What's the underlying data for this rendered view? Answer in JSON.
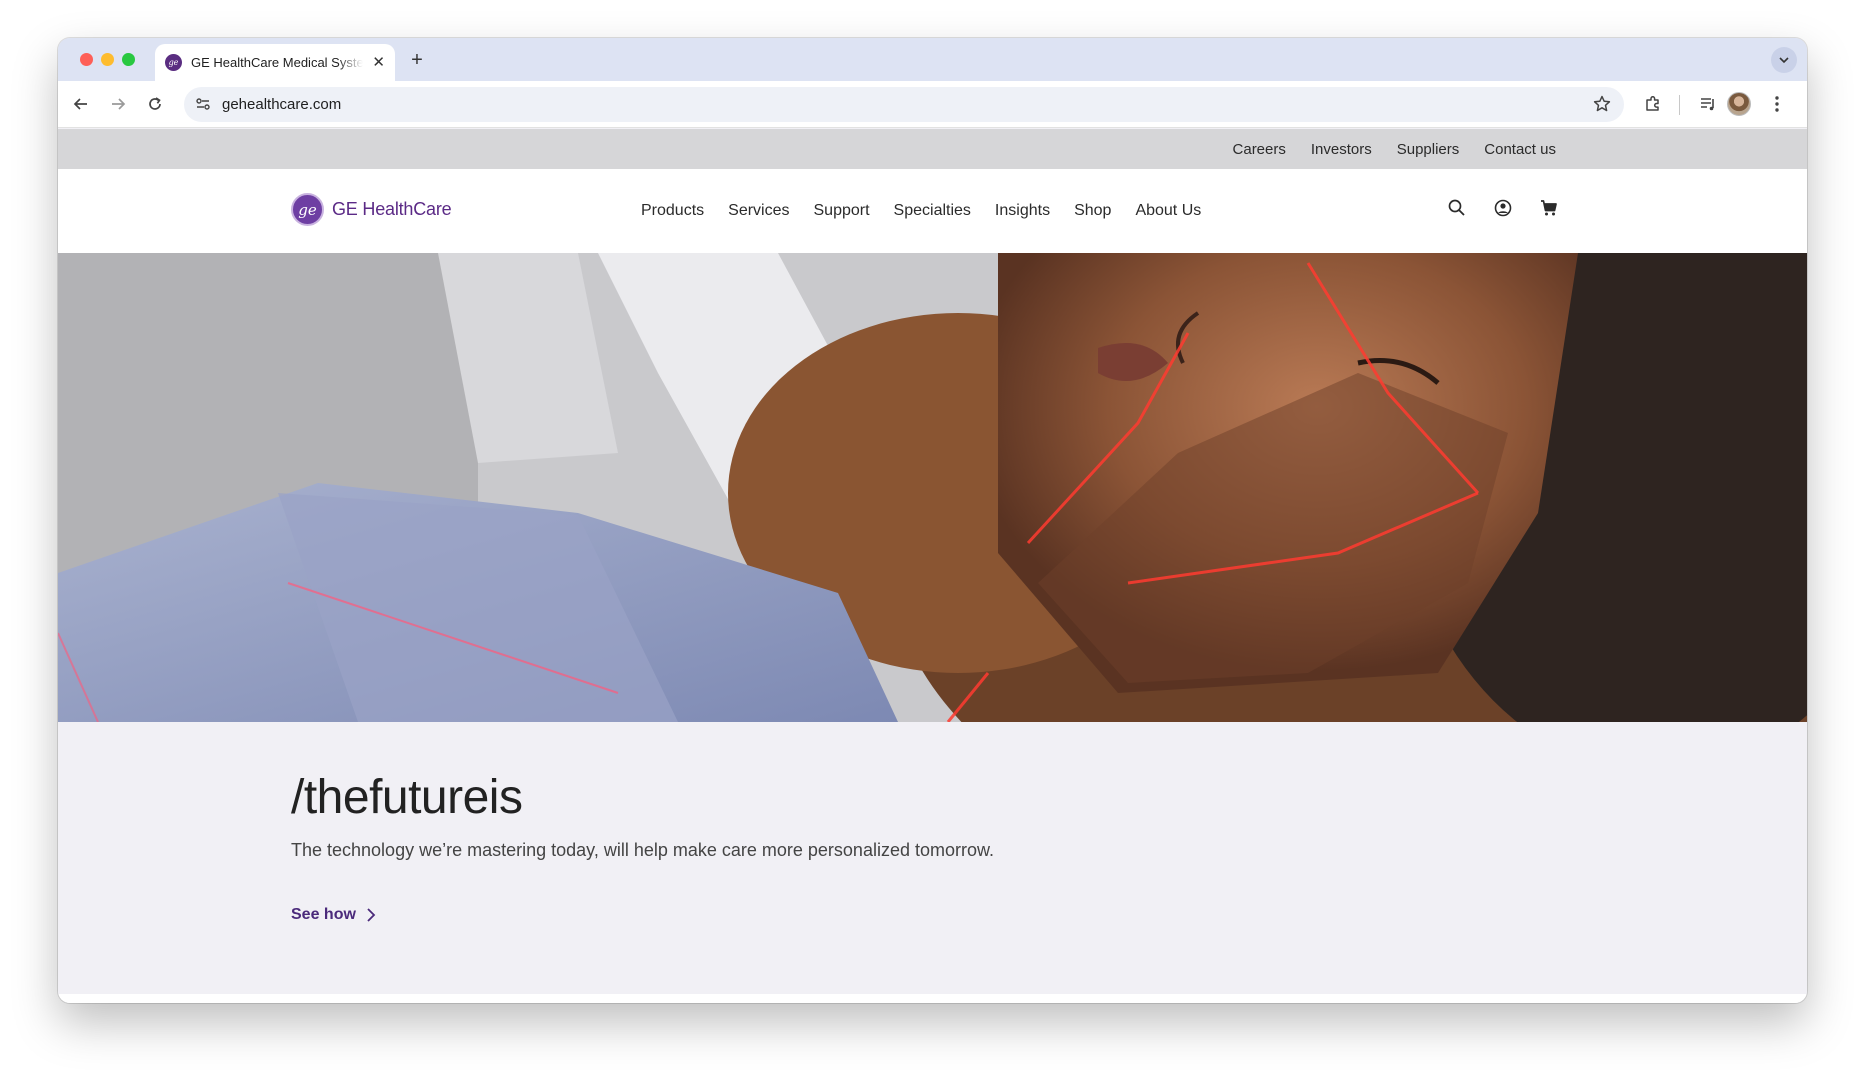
{
  "browser": {
    "tab_title": "GE HealthCare Medical Systems",
    "url": "gehealthcare.com"
  },
  "utility_nav": [
    "Careers",
    "Investors",
    "Suppliers",
    "Contact us"
  ],
  "brand": {
    "name": "GE HealthCare",
    "color": "#5b2a86"
  },
  "main_nav": [
    "Products",
    "Services",
    "Support",
    "Specialties",
    "Insights",
    "Shop",
    "About Us"
  ],
  "nav_icons": [
    "search-icon",
    "account-icon",
    "cart-icon"
  ],
  "hero": {
    "headline": "/thefutureis",
    "subtext": "The technology we’re mastering today, will help make care more personalized tomorrow.",
    "cta_label": "See how",
    "accent_color": "#4b2a7b"
  }
}
